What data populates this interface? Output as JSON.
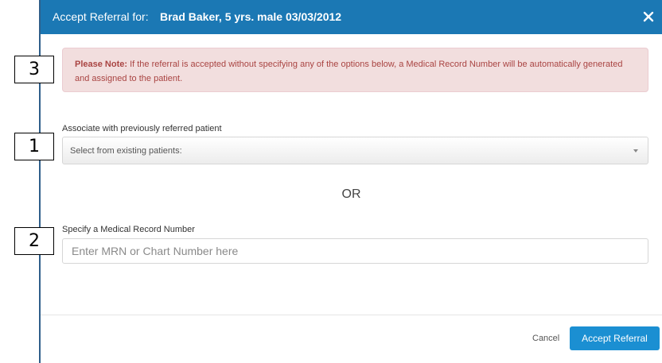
{
  "dialog": {
    "title_prefix": "Accept Referral for:",
    "patient": "Brad Baker, 5 yrs. male 03/03/2012",
    "close_label": "✕",
    "close_icon": "close-icon"
  },
  "note": {
    "label": "Please Note:",
    "text": " If the referral is accepted without specifying any of the options below, a Medical Record Number will be automatically generated and assigned to the patient."
  },
  "associate": {
    "label": "Associate with previously referred patient",
    "selected": "Select from existing patients:"
  },
  "or_text": "OR",
  "mrn": {
    "label": "Specify a Medical Record Number",
    "placeholder": "Enter MRN or Chart Number here",
    "value": ""
  },
  "footer": {
    "cancel_label": "Cancel",
    "accept_label": "Accept Referral"
  },
  "callouts": [
    "3",
    "1",
    "2"
  ],
  "colors": {
    "header": "#1b78b4",
    "accept_button": "#1b8fd2",
    "note_bg": "#f2dede",
    "note_text": "#a94442"
  }
}
